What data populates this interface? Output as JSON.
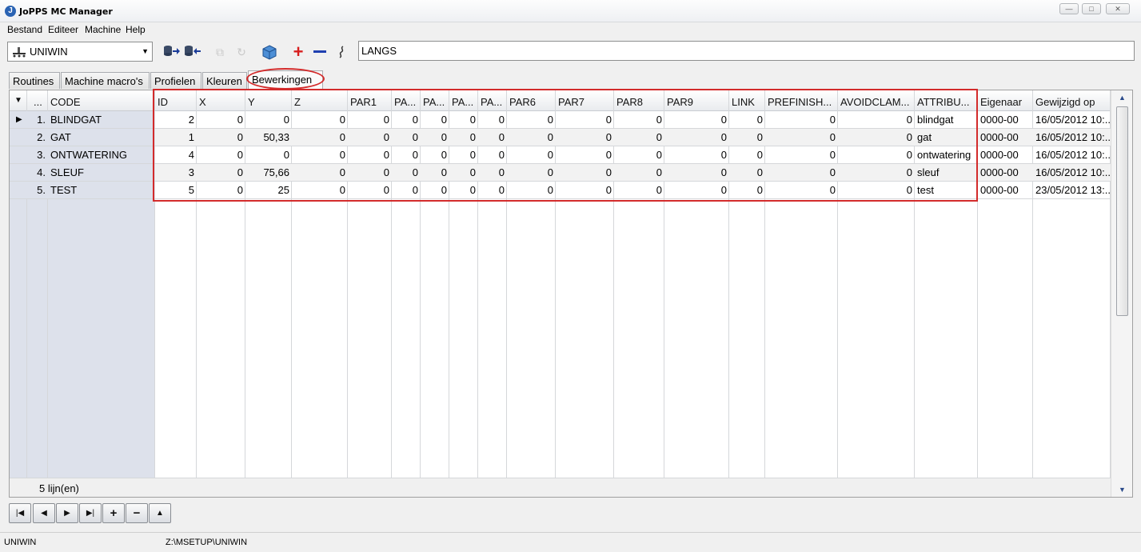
{
  "window": {
    "title": "JoPPS MC Manager",
    "icon": "jopps-app-icon",
    "controls": [
      "minimize",
      "maximize",
      "close"
    ]
  },
  "menu": [
    "Bestand",
    "Editeer",
    "Machine",
    "Help"
  ],
  "toolbar": {
    "machine_select": "UNIWIN",
    "filter_value": "LANGS",
    "icons": [
      "import-db-icon",
      "export-db-icon",
      "copy-icon",
      "refresh-icon",
      "box-icon",
      "add-icon",
      "remove-icon",
      "link-icon"
    ]
  },
  "tabs": [
    {
      "label": "Routines",
      "active": false
    },
    {
      "label": "Machine macro's",
      "active": false
    },
    {
      "label": "Profielen",
      "active": false
    },
    {
      "label": "Kleuren",
      "active": false
    },
    {
      "label": "Bewerkingen",
      "active": true
    }
  ],
  "grid": {
    "columns": [
      "...",
      "CODE",
      "ID",
      "X",
      "Y",
      "Z",
      "PAR1",
      "PA...",
      "PA...",
      "PA...",
      "PA...",
      "PAR6",
      "PAR7",
      "PAR8",
      "PAR9",
      "LINK",
      "PREFINISH...",
      "AVOIDCLAM...",
      "ATTRIBU...",
      "Eigenaar",
      "Gewijzigd op"
    ],
    "rows": [
      {
        "num": "1.",
        "code": "BLINDGAT",
        "id": "2",
        "x": "0",
        "y": "0",
        "z": "0",
        "par1": "0",
        "par2": "0",
        "par3": "0",
        "par4": "0",
        "par5": "0",
        "par6": "0",
        "par7": "0",
        "par8": "0",
        "par9": "0",
        "link": "0",
        "prefinish": "0",
        "avoidclam": "0",
        "attribu": "blindgat",
        "eigenaar": "0000-00",
        "gewijzigd": "16/05/2012 10:..."
      },
      {
        "num": "2.",
        "code": "GAT",
        "id": "1",
        "x": "0",
        "y": "50,33",
        "z": "0",
        "par1": "0",
        "par2": "0",
        "par3": "0",
        "par4": "0",
        "par5": "0",
        "par6": "0",
        "par7": "0",
        "par8": "0",
        "par9": "0",
        "link": "0",
        "prefinish": "0",
        "avoidclam": "0",
        "attribu": "gat",
        "eigenaar": "0000-00",
        "gewijzigd": "16/05/2012 10:..."
      },
      {
        "num": "3.",
        "code": "ONTWATERING",
        "id": "4",
        "x": "0",
        "y": "0",
        "z": "0",
        "par1": "0",
        "par2": "0",
        "par3": "0",
        "par4": "0",
        "par5": "0",
        "par6": "0",
        "par7": "0",
        "par8": "0",
        "par9": "0",
        "link": "0",
        "prefinish": "0",
        "avoidclam": "0",
        "attribu": "ontwatering",
        "eigenaar": "0000-00",
        "gewijzigd": "16/05/2012 10:..."
      },
      {
        "num": "4.",
        "code": "SLEUF",
        "id": "3",
        "x": "0",
        "y": "75,66",
        "z": "0",
        "par1": "0",
        "par2": "0",
        "par3": "0",
        "par4": "0",
        "par5": "0",
        "par6": "0",
        "par7": "0",
        "par8": "0",
        "par9": "0",
        "link": "0",
        "prefinish": "0",
        "avoidclam": "0",
        "attribu": "sleuf",
        "eigenaar": "0000-00",
        "gewijzigd": "16/05/2012 10:..."
      },
      {
        "num": "5.",
        "code": "TEST",
        "id": "5",
        "x": "0",
        "y": "25",
        "z": "0",
        "par1": "0",
        "par2": "0",
        "par3": "0",
        "par4": "0",
        "par5": "0",
        "par6": "0",
        "par7": "0",
        "par8": "0",
        "par9": "0",
        "link": "0",
        "prefinish": "0",
        "avoidclam": "0",
        "attribu": "test",
        "eigenaar": "0000-00",
        "gewijzigd": "23/05/2012 13:..."
      }
    ],
    "footer_count": "5",
    "footer_label": "lijn(en)"
  },
  "navigator": [
    "first-record-icon",
    "prior-record-icon",
    "next-record-icon",
    "last-record-icon",
    "insert-record-icon",
    "delete-record-icon",
    "post-record-icon"
  ],
  "status": {
    "machine": "UNIWIN",
    "path": "Z:\\MSETUP\\UNIWIN"
  },
  "colors": {
    "highlight": "#d32b2b",
    "frozen_column": "#dde1eb"
  }
}
